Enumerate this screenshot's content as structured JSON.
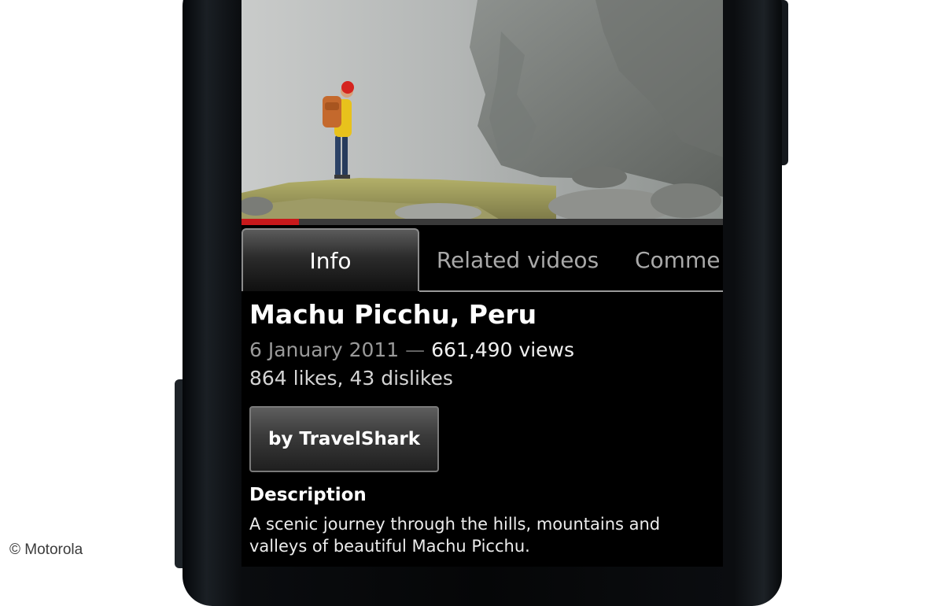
{
  "video": {
    "progress_fraction": 0.12
  },
  "tabs": [
    {
      "label": "Info",
      "active": true
    },
    {
      "label": "Related videos",
      "active": false
    },
    {
      "label": "Comme",
      "active": false
    }
  ],
  "info": {
    "title": "Machu Picchu, Peru",
    "date": "6 January 2011",
    "separator": "—",
    "views": "661,490 views",
    "likes_dislikes": "864 likes, 43 dislikes",
    "author_button": "by TravelShark",
    "description_heading": "Description",
    "description_text": "A scenic journey through the hills, mountains and valleys of beautiful Machu Picchu."
  },
  "watermark": "© Motorola",
  "colors": {
    "progress": "#c8191b",
    "screen_background": "#000000"
  }
}
